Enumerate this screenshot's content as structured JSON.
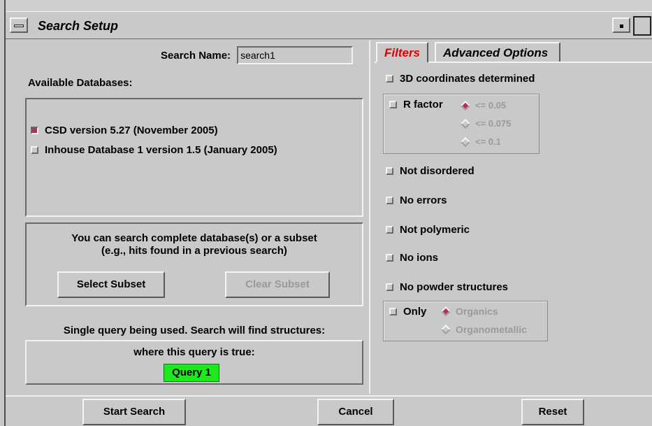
{
  "window": {
    "title": "Search Setup"
  },
  "search_name": {
    "label": "Search Name:",
    "value": "search1"
  },
  "databases": {
    "label": "Available Databases:",
    "items": [
      {
        "label": "CSD version 5.27 (November 2005)",
        "checked": true
      },
      {
        "label": "Inhouse Database 1 version 1.5 (January 2005)",
        "checked": false
      }
    ]
  },
  "subset": {
    "info_line1": "You can search complete database(s) or a subset",
    "info_line2": "(e.g., hits found in a previous search)",
    "select_label": "Select Subset",
    "clear_label": "Clear Subset"
  },
  "query": {
    "summary": "Single query being used. Search will find structures:",
    "condition": "where this query is true:",
    "query_label": "Query 1",
    "query_color": "#1ee81e"
  },
  "tabs": [
    {
      "label": "Filters",
      "active": true,
      "color": "#e00000"
    },
    {
      "label": "Advanced Options",
      "active": false
    }
  ],
  "filters": {
    "coords": "3D coordinates determined",
    "r_factor": {
      "label": "R factor",
      "options": [
        "<= 0.05",
        "<= 0.075",
        "<= 0.1"
      ],
      "selected": 0
    },
    "not_disordered": "Not disordered",
    "no_errors": "No errors",
    "not_polymeric": "Not polymeric",
    "no_ions": "No ions",
    "no_powder": "No powder structures",
    "only": {
      "label": "Only",
      "options": [
        "Organics",
        "Organometallic"
      ],
      "selected": 0
    }
  },
  "footer": {
    "start_label": "Start Search",
    "cancel_label": "Cancel",
    "reset_label": "Reset"
  },
  "colors": {
    "accent_check": "#b03060",
    "background": "#c9c9c9"
  }
}
